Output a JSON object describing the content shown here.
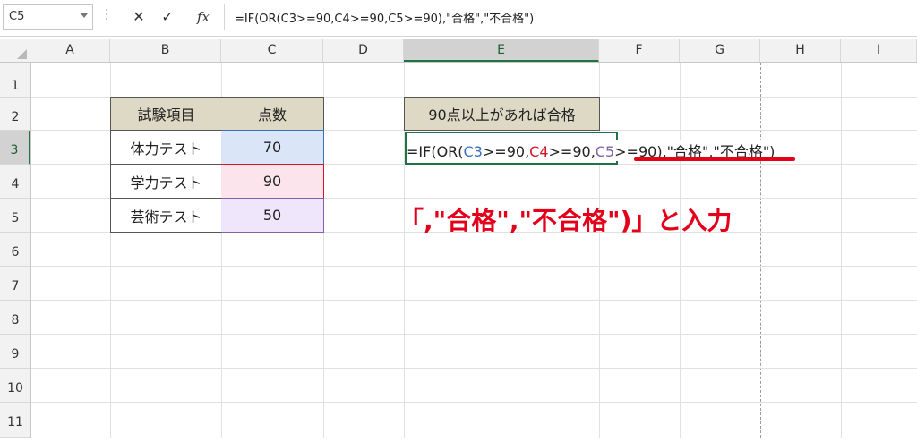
{
  "formula_bar": {
    "name_box": "C5",
    "cancel_symbol": "✕",
    "confirm_symbol": "✓",
    "fx_label": "fx",
    "formula": "=IF(OR(C3>=90,C4>=90,C5>=90),\"合格\",\"不合格\")"
  },
  "columns": [
    "A",
    "B",
    "C",
    "D",
    "E",
    "F",
    "G",
    "H",
    "I"
  ],
  "rows": [
    "1",
    "2",
    "3",
    "4",
    "5",
    "6",
    "7",
    "8",
    "9",
    "10",
    "11"
  ],
  "active_column": "E",
  "active_row": "3",
  "table": {
    "header_item": "試験項目",
    "header_score": "点数",
    "rows": [
      {
        "item": "体力テスト",
        "score": "70"
      },
      {
        "item": "学力テスト",
        "score": "90"
      },
      {
        "item": "芸術テスト",
        "score": "50"
      }
    ]
  },
  "e2_label": "90点以上があれば合格",
  "edit_cell": {
    "prefix": "=IF(OR(",
    "ref1": "C3",
    "part1": ">=90,",
    "ref2": "C4",
    "part2": ">=90,",
    "ref3": "C5",
    "part3": ">=90)",
    "suffix": ",\"合格\",\"不合格\")"
  },
  "annotation": "「,\"合格\",\"不合格\")」と入力",
  "colors": {
    "header_fill": "#ddd9c4",
    "c3_fill": "#dae6f8",
    "c4_fill": "#fce4ec",
    "c5_fill": "#f0e6fb",
    "annotation": "#e3001b",
    "excel_green": "#217346"
  }
}
